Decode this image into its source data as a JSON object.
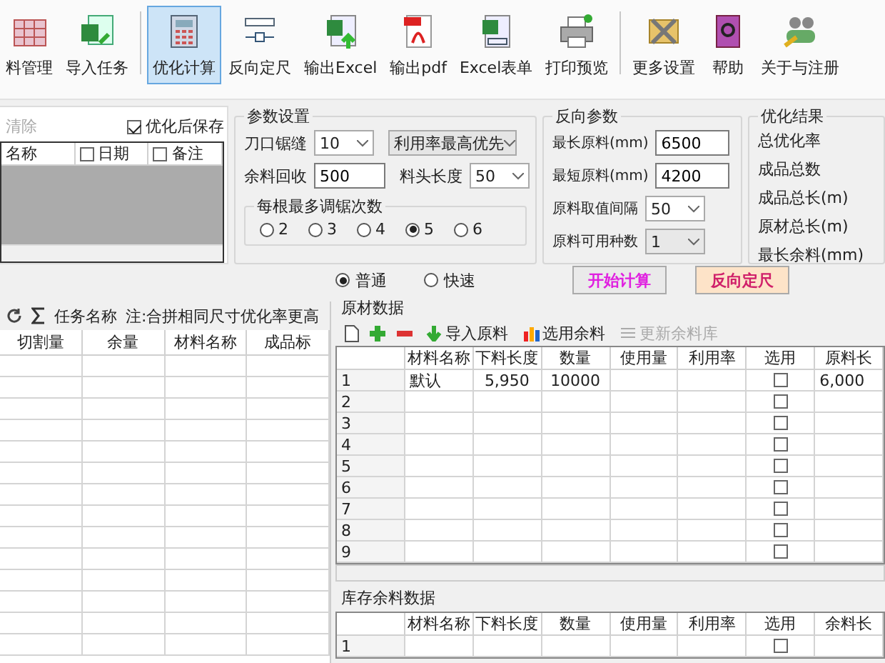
{
  "toolbar": {
    "items": [
      {
        "label": "料管理",
        "selected": false
      },
      {
        "label": "导入任务",
        "selected": false
      },
      {
        "label": "优化计算",
        "selected": true
      },
      {
        "label": "反向定尺",
        "selected": false
      },
      {
        "label": "输出Excel",
        "selected": false
      },
      {
        "label": "输出pdf",
        "selected": false
      },
      {
        "label": "Excel表单",
        "selected": false
      },
      {
        "label": "打印预览",
        "selected": false
      },
      {
        "label": "更多设置",
        "selected": false
      },
      {
        "label": "帮助",
        "selected": false
      },
      {
        "label": "关于与注册",
        "selected": false
      }
    ]
  },
  "task_list": {
    "clear_button": {
      "label": "清除",
      "disabled": true
    },
    "save_checkbox": {
      "label": "优化后保存",
      "checked": true
    },
    "columns": [
      "名称",
      "日期",
      "备注"
    ]
  },
  "params": {
    "title": "参数设置",
    "fields": [
      {
        "label": "刀口锯缝",
        "kind": "select",
        "value": "10"
      },
      {
        "kind": "select",
        "value": "利用率最高优先"
      },
      {
        "label": "余料回收",
        "kind": "input",
        "value": "500"
      },
      {
        "label": "料头长度",
        "kind": "select",
        "value": "50"
      }
    ],
    "cuts": {
      "title": "每根最多调锯次数",
      "options": [
        {
          "label": "2",
          "selected": false
        },
        {
          "label": "3",
          "selected": false
        },
        {
          "label": "4",
          "selected": false
        },
        {
          "label": "5",
          "selected": true
        },
        {
          "label": "6",
          "selected": false
        }
      ]
    }
  },
  "reverse": {
    "title": "反向参数",
    "fields": [
      {
        "label": "最长原料(mm)",
        "kind": "input",
        "value": "6500",
        "disabled": false
      },
      {
        "label": "最短原料(mm)",
        "kind": "input",
        "value": "4200",
        "disabled": false
      },
      {
        "label": "原料取值间隔",
        "kind": "select",
        "value": "50",
        "disabled": false
      },
      {
        "label": "原料可用种数",
        "kind": "select",
        "value": "1",
        "disabled": true
      }
    ]
  },
  "results": {
    "title": "优化结果",
    "items": [
      "总优化率",
      "成品总数",
      "成品总长(m)",
      "原材总长(m)",
      "最长余料(mm)"
    ]
  },
  "mode": [
    {
      "label": "普通",
      "selected": true
    },
    {
      "label": "快速",
      "selected": false
    }
  ],
  "actions": [
    {
      "label": "开始计算",
      "kind": "start"
    },
    {
      "label": "反向定尺",
      "kind": "reverse"
    }
  ],
  "tasks": {
    "title": "任务名称",
    "note": "注:合拼相同尺寸优化率更高",
    "columns": [
      "切割量",
      "余量",
      "材料名称",
      "成品标"
    ]
  },
  "raw_materials": {
    "title": "原材数据",
    "tools": [
      {
        "kind": "new"
      },
      {
        "kind": "add"
      },
      {
        "kind": "remove"
      },
      {
        "kind": "import",
        "label": "导入原料",
        "disabled": false
      },
      {
        "kind": "use-remnant",
        "label": "选用余料",
        "disabled": false
      },
      {
        "kind": "update",
        "label": "更新余料库",
        "disabled": true
      }
    ],
    "columns": [
      "材料名称",
      "下料长度",
      "数量",
      "使用量",
      "利用率",
      "选用",
      "原料长"
    ],
    "rows": [
      {
        "number": "1",
        "name": "默认",
        "length": "5,950",
        "quantity": "10000",
        "checked": false,
        "raw_length": "6,000"
      },
      {
        "number": "2",
        "checked": false
      },
      {
        "number": "3",
        "checked": false
      },
      {
        "number": "4",
        "checked": false
      },
      {
        "number": "5",
        "checked": false
      },
      {
        "number": "6",
        "checked": false
      },
      {
        "number": "7",
        "checked": false
      },
      {
        "number": "8",
        "checked": false
      },
      {
        "number": "9",
        "checked": false
      }
    ]
  },
  "stock": {
    "title": "库存余料数据",
    "columns": [
      "材料名称",
      "下料长度",
      "数量",
      "使用量",
      "利用率",
      "选用",
      "余料长"
    ],
    "rows": [
      {
        "number": "1",
        "checked": false
      }
    ]
  }
}
